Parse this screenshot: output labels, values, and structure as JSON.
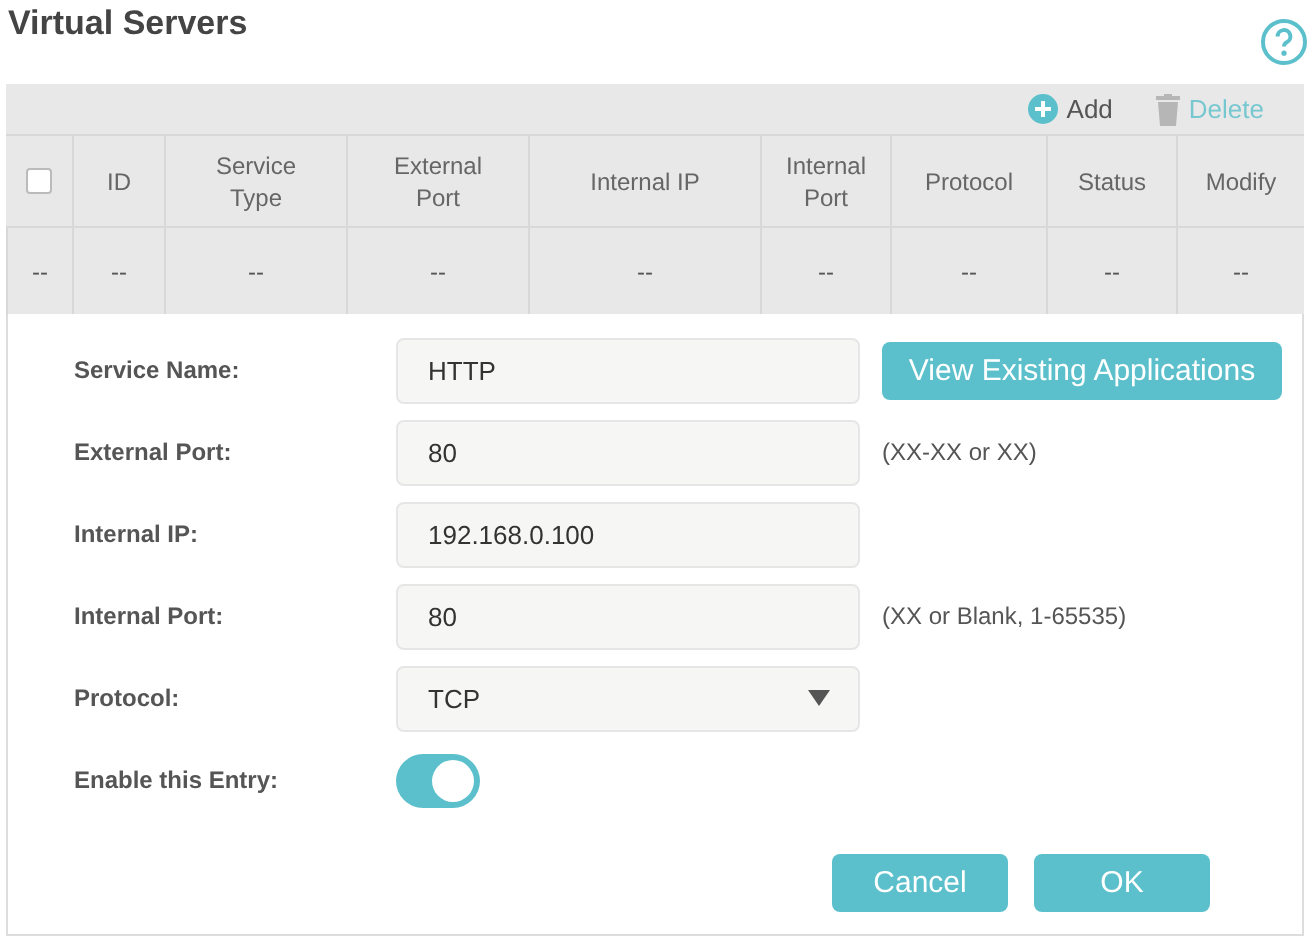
{
  "page": {
    "title": "Virtual Servers"
  },
  "toolbar": {
    "add": "Add",
    "delete": {
      "label": "Delete",
      "disabled": true
    }
  },
  "table": {
    "columns": [
      {
        "kind": "checkbox",
        "checked": false
      },
      {
        "kind": "text",
        "label": "ID"
      },
      {
        "kind": "text",
        "label": "Service Type"
      },
      {
        "kind": "text",
        "label": "External Port"
      },
      {
        "kind": "text",
        "label": "Internal IP"
      },
      {
        "kind": "text",
        "label": "Internal Port"
      },
      {
        "kind": "text",
        "label": "Protocol"
      },
      {
        "kind": "text",
        "label": "Status"
      },
      {
        "kind": "text",
        "label": "Modify"
      }
    ],
    "rows": [
      {
        "cells": [
          "--",
          "--",
          "--",
          "--",
          "--",
          "--",
          "--",
          "--",
          "--"
        ]
      }
    ]
  },
  "form": {
    "fields": [
      {
        "kind": "text",
        "label": "Service Name:",
        "value": "HTTP",
        "action": "View Existing Applications"
      },
      {
        "kind": "text",
        "label": "External Port:",
        "value": "80",
        "hint": "(XX-XX or XX)"
      },
      {
        "kind": "text",
        "label": "Internal IP:",
        "value": "192.168.0.100"
      },
      {
        "kind": "text",
        "label": "Internal Port:",
        "value": "80",
        "hint": "(XX or Blank, 1-65535)"
      },
      {
        "kind": "select",
        "label": "Protocol:",
        "value": "TCP"
      },
      {
        "kind": "toggle",
        "label": "Enable this Entry:",
        "on": true
      }
    ],
    "buttons": [
      "Cancel",
      "OK"
    ]
  }
}
